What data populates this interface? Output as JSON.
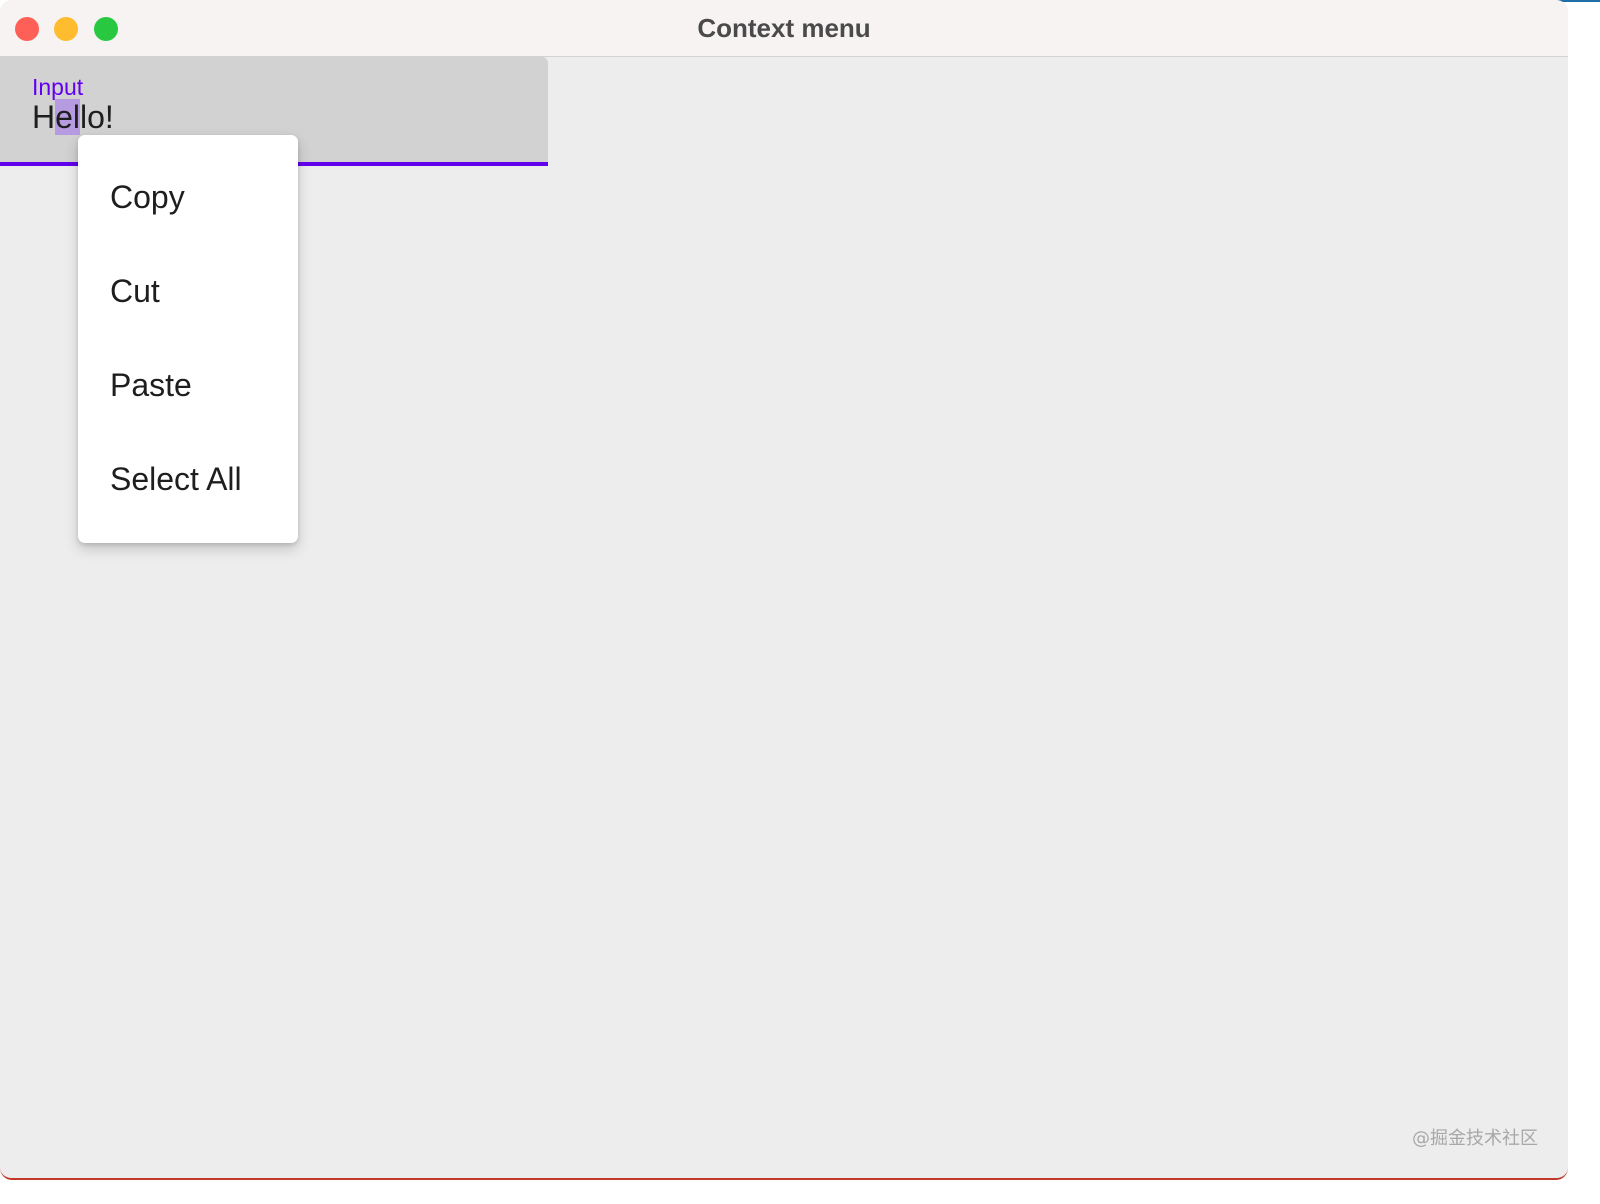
{
  "window": {
    "title": "Context menu"
  },
  "textfield": {
    "label": "Input",
    "value_before": "H",
    "value_selected": "el",
    "value_after": "lo!"
  },
  "context_menu": {
    "items": [
      {
        "label": "Copy"
      },
      {
        "label": "Cut"
      },
      {
        "label": "Paste"
      },
      {
        "label": "Select All"
      }
    ]
  },
  "watermark": "@掘金技术社区",
  "colors": {
    "accent": "#6200ee",
    "selection": "#b79be0",
    "close": "#fe5f57",
    "minimize": "#febc2e",
    "zoom": "#28c840"
  }
}
